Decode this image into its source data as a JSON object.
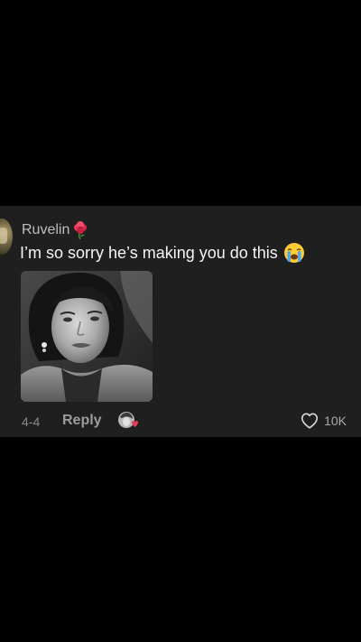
{
  "comment": {
    "username": "Ruvelin",
    "username_badge_icon": "rose-emoji-icon",
    "text": "I’m so sorry he’s making you do this",
    "text_emoji_icon": "loudly-crying-face-emoji-icon",
    "photo_icon": "woman-portrait-photo",
    "date": "4-4",
    "reply_label": "Reply",
    "creator_liked_icon": "creator-liked-avatar-icon",
    "like_icon": "heart-outline-icon",
    "like_count": "10K"
  },
  "colors": {
    "background": "#000000",
    "card": "#1f1f1f",
    "username": "#bdbdbd",
    "text": "#f5f5f5",
    "meta": "#8a8a8a",
    "accent_red": "#e63a5a"
  }
}
